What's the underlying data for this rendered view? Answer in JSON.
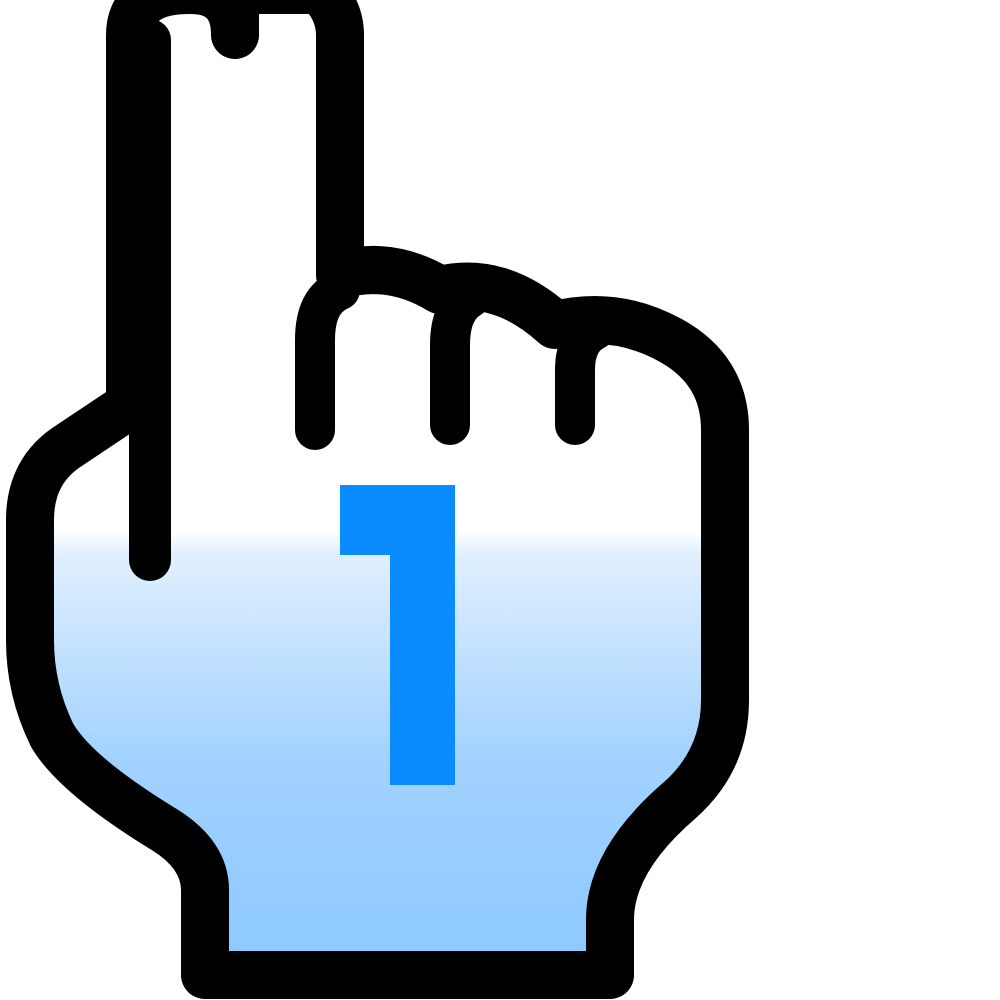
{
  "icon": {
    "name": "pointing-hand-one-icon",
    "digit": "1",
    "colors": {
      "outline": "#000000",
      "digit": "#0a8cff",
      "fill_top": "#ffffff",
      "fill_light": "#d8ecff",
      "fill_bottom": "#8cc8ff"
    }
  }
}
